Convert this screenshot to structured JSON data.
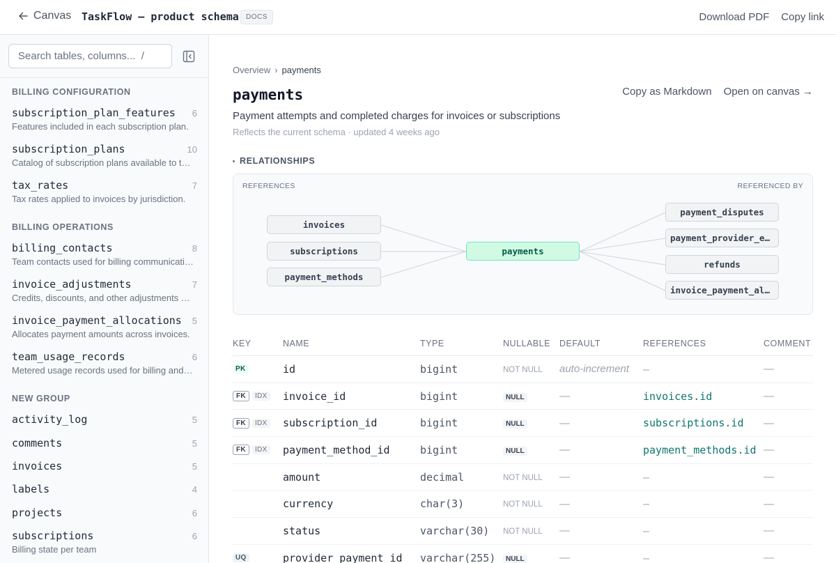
{
  "topbar": {
    "back_label": "Canvas",
    "doc_title": "TaskFlow — product schema",
    "doc_badge": "DOCS",
    "download_label": "Download PDF",
    "copy_link_label": "Copy link"
  },
  "sidebar": {
    "search_placeholder": "Search tables, columns...  /",
    "groups": [
      {
        "title": "BILLING CONFIGURATION",
        "items": [
          {
            "name": "subscription_plan_features",
            "count": "6",
            "desc": "Features included in each subscription plan."
          },
          {
            "name": "subscription_plans",
            "count": "10",
            "desc": "Catalog of subscription plans available to teams."
          },
          {
            "name": "tax_rates",
            "count": "7",
            "desc": "Tax rates applied to invoices by jurisdiction."
          }
        ]
      },
      {
        "title": "BILLING OPERATIONS",
        "items": [
          {
            "name": "billing_contacts",
            "count": "8",
            "desc": "Team contacts used for billing communications."
          },
          {
            "name": "invoice_adjustments",
            "count": "7",
            "desc": "Credits, discounts, and other adjustments applied."
          },
          {
            "name": "invoice_payment_allocations",
            "count": "5",
            "desc": "Allocates payment amounts across invoices."
          },
          {
            "name": "team_usage_records",
            "count": "6",
            "desc": "Metered usage records used for billing and limits."
          }
        ]
      },
      {
        "title": "NEW GROUP",
        "items": [
          {
            "name": "activity_log",
            "count": "5",
            "desc": ""
          },
          {
            "name": "comments",
            "count": "5",
            "desc": ""
          },
          {
            "name": "invoices",
            "count": "5",
            "desc": ""
          },
          {
            "name": "labels",
            "count": "4",
            "desc": ""
          },
          {
            "name": "projects",
            "count": "6",
            "desc": ""
          },
          {
            "name": "subscriptions",
            "count": "6",
            "desc": "Billing state per team"
          }
        ]
      }
    ]
  },
  "main": {
    "breadcrumb": {
      "root": "Overview",
      "sep": "›",
      "current": "payments"
    },
    "title": "payments",
    "copy_markdown_label": "Copy as Markdown",
    "open_canvas_label": "Open on canvas →",
    "description": "Payment attempts and completed charges for invoices or subscriptions",
    "meta": "Reflects the current schema · updated 4 weeks ago",
    "relationships": {
      "title": "RELATIONSHIPS",
      "references_label": "REFERENCES",
      "referenced_by_label": "REFERENCED BY",
      "center": "payments",
      "references": [
        "invoices",
        "subscriptions",
        "payment_methods"
      ],
      "referenced_by": [
        "payment_disputes",
        "payment_provider_events",
        "refunds",
        "invoice_payment_allocations"
      ]
    },
    "columns_header": {
      "key": "KEY",
      "name": "NAME",
      "type": "TYPE",
      "nullable": "NULLABLE",
      "default": "DEFAULT",
      "references": "REFERENCES",
      "comment": "COMMENT"
    },
    "columns": [
      {
        "keys": [
          "PK"
        ],
        "name": "id",
        "type": "bigint",
        "nullable": "NOT NULL",
        "default": "auto-increment",
        "references": "—",
        "comment": "—"
      },
      {
        "keys": [
          "FK",
          "IDX"
        ],
        "name": "invoice_id",
        "type": "bigint",
        "nullable": "NULL",
        "default": "—",
        "references": "invoices.id",
        "comment": "—"
      },
      {
        "keys": [
          "FK",
          "IDX"
        ],
        "name": "subscription_id",
        "type": "bigint",
        "nullable": "NULL",
        "default": "—",
        "references": "subscriptions.id",
        "comment": "—"
      },
      {
        "keys": [
          "FK",
          "IDX"
        ],
        "name": "payment_method_id",
        "type": "bigint",
        "nullable": "NULL",
        "default": "—",
        "references": "payment_methods.id",
        "comment": "—"
      },
      {
        "keys": [],
        "name": "amount",
        "type": "decimal",
        "nullable": "NOT NULL",
        "default": "—",
        "references": "—",
        "comment": "—"
      },
      {
        "keys": [],
        "name": "currency",
        "type": "char(3)",
        "nullable": "NOT NULL",
        "default": "—",
        "references": "—",
        "comment": "—"
      },
      {
        "keys": [],
        "name": "status",
        "type": "varchar(30)",
        "nullable": "NOT NULL",
        "default": "—",
        "references": "—",
        "comment": "—"
      },
      {
        "keys": [
          "UQ"
        ],
        "name": "provider_payment_id",
        "type": "varchar(255)",
        "nullable": "NULL",
        "default": "—",
        "references": "—",
        "comment": "—"
      }
    ]
  },
  "colors": {
    "accent": "#0f766e",
    "center_node_bg": "#d1fae5",
    "center_node_border": "#6ee7b7"
  }
}
